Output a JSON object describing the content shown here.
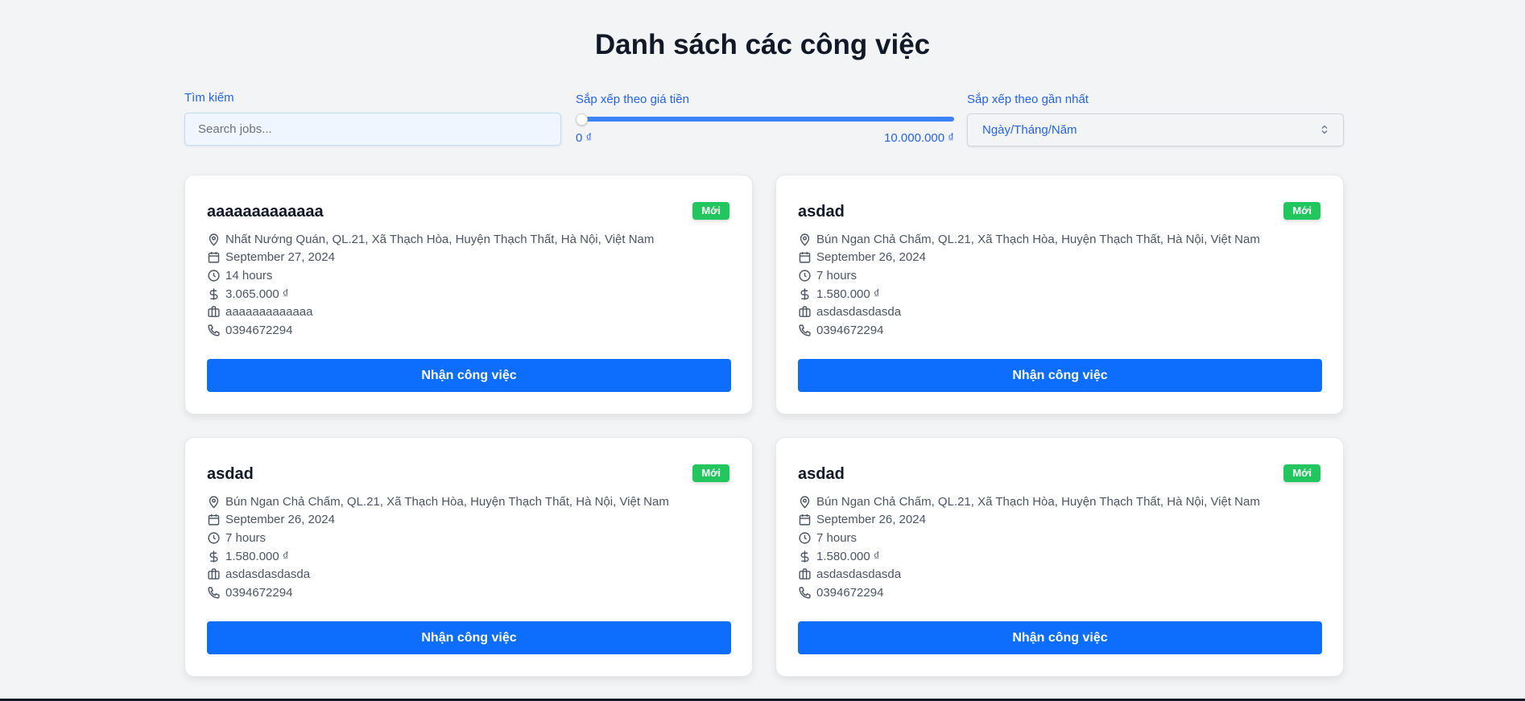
{
  "header": {
    "title": "Danh sách các công việc"
  },
  "filters": {
    "search": {
      "label": "Tìm kiếm",
      "placeholder": "Search jobs..."
    },
    "price": {
      "label": "Sắp xếp theo giá tiền",
      "min_label": "0 ₫",
      "max_label": "10.000.000 ₫",
      "value_fraction": 0
    },
    "date": {
      "label": "Sắp xếp theo gần nhất",
      "selected": "Ngày/Tháng/Năm"
    }
  },
  "jobs": [
    {
      "title": "aaaaaaaaaaaaa",
      "badge": "Mới",
      "address": "Nhất Nướng Quán, QL.21, Xã Thạch Hòa, Huyện Thạch Thất, Hà Nội, Việt Nam",
      "date": "September 27, 2024",
      "duration": "14 hours",
      "salary": "3.065.000 ₫",
      "description": "aaaaaaaaaaaaa",
      "phone": "0394672294",
      "button": "Nhận công việc"
    },
    {
      "title": "asdad",
      "badge": "Mới",
      "address": "Bún Ngan Chả Chấm, QL.21, Xã Thạch Hòa, Huyện Thạch Thất, Hà Nội, Việt Nam",
      "date": "September 26, 2024",
      "duration": "7 hours",
      "salary": "1.580.000 ₫",
      "description": "asdasdasdasda",
      "phone": "0394672294",
      "button": "Nhận công việc"
    },
    {
      "title": "asdad",
      "badge": "Mới",
      "address": "Bún Ngan Chả Chấm, QL.21, Xã Thạch Hòa, Huyện Thạch Thất, Hà Nội, Việt Nam",
      "date": "September 26, 2024",
      "duration": "7 hours",
      "salary": "1.580.000 ₫",
      "description": "asdasdasdasda",
      "phone": "0394672294",
      "button": "Nhận công việc"
    },
    {
      "title": "asdad",
      "badge": "Mới",
      "address": "Bún Ngan Chả Chấm, QL.21, Xã Thạch Hòa, Huyện Thạch Thất, Hà Nội, Việt Nam",
      "date": "September 26, 2024",
      "duration": "7 hours",
      "salary": "1.580.000 ₫",
      "description": "asdasdasdasda",
      "phone": "0394672294",
      "button": "Nhận công việc"
    }
  ],
  "icons": [
    "map-pin-icon",
    "calendar-icon",
    "clock-icon",
    "dollar-icon",
    "briefcase-icon",
    "phone-icon"
  ],
  "colors": {
    "accent": "#0d6efd",
    "badge": "#22c55e",
    "label": "#2563eb"
  }
}
